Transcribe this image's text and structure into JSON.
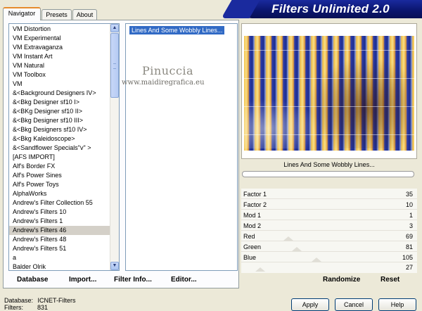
{
  "app_title": "Filters Unlimited 2.0",
  "tabs": [
    {
      "label": "Navigator",
      "active": true
    },
    {
      "label": "Presets",
      "active": false
    },
    {
      "label": "About",
      "active": false
    }
  ],
  "categories": [
    "VM Distortion",
    "VM Experimental",
    "VM Extravaganza",
    "VM Instant Art",
    "VM Natural",
    "VM Toolbox",
    "VM",
    "&<Background Designers IV>",
    "&<Bkg Designer sf10 I>",
    "&<BKg Designer sf10 II>",
    "&<Bkg Designer sf10 III>",
    "&<Bkg Designers sf10 IV>",
    "&<Bkg Kaleidoscope>",
    "&<Sandflower Specials\"v\" >",
    "[AFS IMPORT]",
    "Alf's Border FX",
    "Alf's Power Sines",
    "Alf's Power Toys",
    "AlphaWorks",
    "Andrew's Filter Collection 55",
    "Andrew's Filters 10",
    "Andrew's Filters 1",
    "Andrew's Filters 46",
    "Andrew's Filters 48",
    "Andrew's Filters 51",
    "a",
    "Balder Olrik"
  ],
  "selected_category_index": 22,
  "filters": [
    "Lines And Some Wobbly Lines..."
  ],
  "watermark": {
    "name": "Pinuccia",
    "url": "www.maidiregrafica.eu"
  },
  "preview_filter_name": "Lines And Some Wobbly Lines...",
  "sliders": [
    {
      "label": "Factor 1",
      "value": "35"
    },
    {
      "label": "Factor 2",
      "value": "10"
    },
    {
      "label": "Mod 1",
      "value": "1"
    },
    {
      "label": "Mod 2",
      "value": "3"
    },
    {
      "label": "Red",
      "value": "69"
    },
    {
      "label": "Green",
      "value": "81"
    },
    {
      "label": "Blue",
      "value": "105"
    },
    {
      "label": "",
      "value": "27"
    }
  ],
  "bottom_buttons": {
    "database": "Database",
    "import": "Import...",
    "filter_info": "Filter Info...",
    "editor": "Editor...",
    "randomize": "Randomize",
    "reset": "Reset"
  },
  "status": {
    "database_label": "Database:",
    "database_value": "ICNET-Filters",
    "filters_label": "Filters:",
    "filters_value": "831"
  },
  "dialog_buttons": {
    "apply": "Apply",
    "cancel": "Cancel",
    "help": "Help"
  },
  "colors": {
    "banner": "#0b1670",
    "selection": "#316ac5",
    "tab_accent": "#e68b2c"
  }
}
